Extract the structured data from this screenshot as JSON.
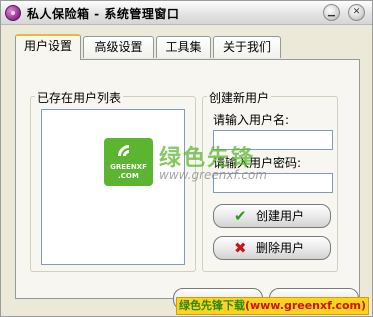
{
  "window": {
    "title": "私人保险箱 - 系统管理窗口"
  },
  "tabs": [
    {
      "label": "用户设置",
      "active": true
    },
    {
      "label": "高级设置",
      "active": false
    },
    {
      "label": "工具集",
      "active": false
    },
    {
      "label": "关于我们",
      "active": false
    }
  ],
  "users_group": {
    "legend": "已存在用户列表",
    "items": []
  },
  "create_group": {
    "legend": "创建新用户",
    "username_label": "请输入用户名:",
    "username_value": "",
    "password_label": "请输入用户密码:",
    "password_value": "",
    "create_button": "创建用户",
    "delete_button": "删除用户"
  },
  "watermark": {
    "logo_name": "GREENXF",
    "logo_domain": ".COM",
    "brand": "绿色先锋",
    "url": "www.greenxf.com"
  },
  "banner": {
    "part1": "绿色先锋下载",
    "part2": "(www.greenxf.com)"
  },
  "colors": {
    "accent_tab": "#f2b43c",
    "check_green": "#2f9a21",
    "delete_red": "#c8141e",
    "banner_yellow": "#ffd21e"
  },
  "icons": [
    "app-icon",
    "minimize-icon",
    "close-icon",
    "check-icon",
    "delete-x-icon"
  ]
}
